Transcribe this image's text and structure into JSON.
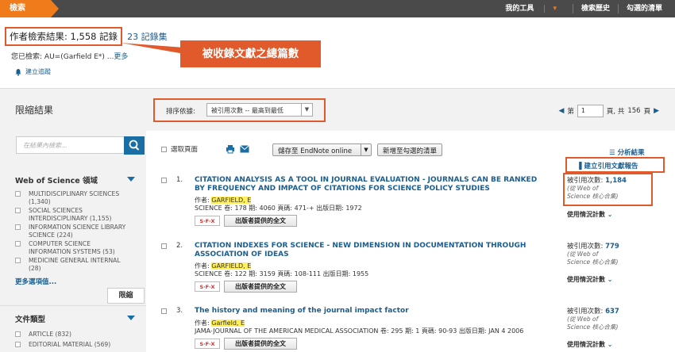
{
  "topbar": {
    "search_tab": "檢索",
    "links": [
      "我的工具",
      "檢索歷史",
      "勾選的清單"
    ]
  },
  "results": {
    "summary": "作者檢索結果: 1,558 記錄",
    "record_set": "23 記錄集",
    "callout": "被收錄文獻之總篇數",
    "query_label": "您已檢索:",
    "query_text": "AU=(Garfield E*) ...",
    "query_more": "更多",
    "alert_label": "建立追蹤"
  },
  "sidebar": {
    "title": "限縮結果",
    "search_placeholder": "在結果內檢索...",
    "section1": "Web of Science 領域",
    "categories": [
      "MULTIDISCIPLINARY SCIENCES (1,340)",
      "SOCIAL SCIENCES INTERDISCIPLINARY (1,155)",
      "INFORMATION SCIENCE LIBRARY SCIENCE (224)",
      "COMPUTER SCIENCE INFORMATION SYSTEMS (53)",
      "MEDICINE GENERAL INTERNAL (28)"
    ],
    "more_options": "更多選項值...",
    "limit_button": "限縮",
    "section2": "文件類型",
    "doc_types": [
      "ARTICLE (832)",
      "EDITORIAL MATERIAL (569)"
    ]
  },
  "sort": {
    "label": "排序依據:",
    "selected": "被引用次數 -- 最高到最低",
    "page_label": "第",
    "page_value": "1",
    "of_label": "頁, 共",
    "total_pages": "156",
    "pages_suffix": "頁"
  },
  "toolbar": {
    "select_page": "選取頁面",
    "save_to": "儲存至 EndNote online",
    "add_to_list": "新增至勾選的清單",
    "analyze": "分析結果",
    "citation_report": "建立引用文獻報告"
  },
  "records": [
    {
      "num": "1.",
      "title": "CITATION ANALYSIS AS A TOOL IN JOURNAL EVALUATION - JOURNALS CAN BE RANKED BY FREQUENCY AND IMPACT OF CITATIONS FOR SCIENCE POLICY STUDIES",
      "author_label": "作者:",
      "author": "GARFIELD, E",
      "source": "SCIENCE  卷: 178  期: 4060  頁碼: 471-+  出版日期: 1972",
      "cited_label": "被引用次數:",
      "cited": "1,184",
      "cited_src": "(從 Web of Science 核心合集)",
      "usage": "使用情況計數"
    },
    {
      "num": "2.",
      "title": "CITATION INDEXES FOR SCIENCE - NEW DIMENSION IN DOCUMENTATION THROUGH ASSOCIATION OF IDEAS",
      "author_label": "作者:",
      "author": "GARFIELD, E",
      "source": "SCIENCE  卷: 122  期: 3159  頁碼: 108-111  出版日期: 1955",
      "cited_label": "被引用次數:",
      "cited": "779",
      "cited_src": "(從 Web of Science 核心合集)",
      "usage": "使用情況計數"
    },
    {
      "num": "3.",
      "title": "The history and meaning of the journal impact factor",
      "author_label": "作者:",
      "author": "Garfield, E",
      "source": "JAMA-JOURNAL OF THE AMERICAN MEDICAL ASSOCIATION  卷: 295  期: 1  頁碼: 90-93  出版日期: JAN 4 2006",
      "cited_label": "被引用次數:",
      "cited": "637",
      "cited_src": "(從 Web of Science 核心合集)",
      "usage": "使用情況計數"
    }
  ],
  "fulltext_label": "出版者提供的全文",
  "sfx_label": "S·F·X",
  "colors": {
    "accent": "#f07b1b",
    "callout": "#e05a2b",
    "link": "#1a5d8f",
    "highlight": "#ffef5c"
  }
}
